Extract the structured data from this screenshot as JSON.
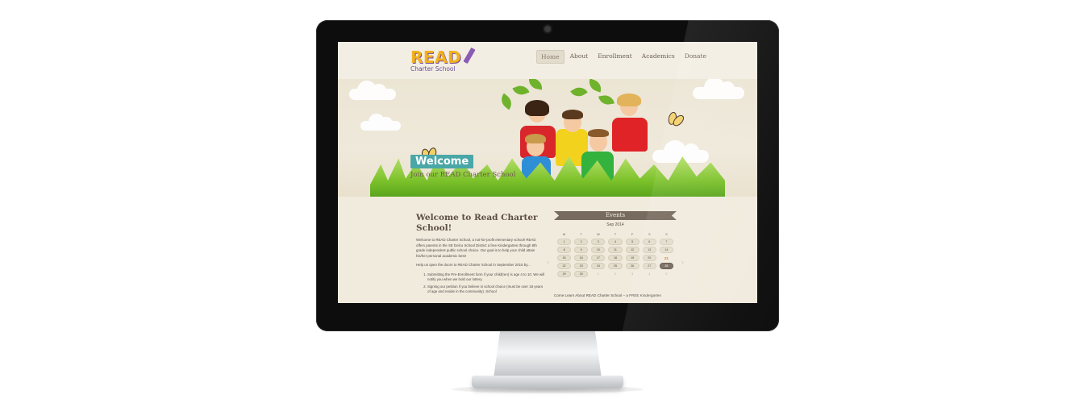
{
  "site": {
    "logo_main": "READ",
    "logo_sub": "Charter School"
  },
  "nav": [
    {
      "label": "Home",
      "active": true
    },
    {
      "label": "About",
      "active": false
    },
    {
      "label": "Enrollment",
      "active": false
    },
    {
      "label": "Academics",
      "active": false
    },
    {
      "label": "Donate",
      "active": false
    }
  ],
  "hero": {
    "badge": "Welcome",
    "subtitle": "Join our READ Charter School"
  },
  "main": {
    "heading": "Welcome to Read Charter School!",
    "intro": "Welcome to READ Charter School, a not-for-profit elementary school! READ offers parents in the SE Delco School District a free Kindergarten through 8th grade independent public school choice. Our goal is to help your child attain his/her personal academic best!",
    "cta": "Help us open the doors to READ Charter School in September 2015 by...",
    "steps": [
      "Submitting the Pre-Enrollment form if your child(ren) is age 4 to 10. We will notify you when we hold our lottery.",
      "Signing our petition if you believe in school choice (must be over 18 years of age and reside in the community). School"
    ]
  },
  "events": {
    "title": "Events",
    "month": "Sep 2014",
    "weekdays": [
      "M",
      "T",
      "W",
      "T",
      "F",
      "S",
      "S"
    ],
    "weeks": [
      [
        {
          "d": "1"
        },
        {
          "d": "2"
        },
        {
          "d": "3"
        },
        {
          "d": "4"
        },
        {
          "d": "5"
        },
        {
          "d": "6"
        },
        {
          "d": "7"
        }
      ],
      [
        {
          "d": "8"
        },
        {
          "d": "9"
        },
        {
          "d": "10"
        },
        {
          "d": "11"
        },
        {
          "d": "12"
        },
        {
          "d": "13"
        },
        {
          "d": "14"
        }
      ],
      [
        {
          "d": "15"
        },
        {
          "d": "16"
        },
        {
          "d": "17"
        },
        {
          "d": "18"
        },
        {
          "d": "19"
        },
        {
          "d": "20"
        },
        {
          "d": "21",
          "state": "today"
        }
      ],
      [
        {
          "d": "22"
        },
        {
          "d": "23"
        },
        {
          "d": "24"
        },
        {
          "d": "25"
        },
        {
          "d": "26"
        },
        {
          "d": "27"
        },
        {
          "d": "28",
          "state": "selected"
        }
      ],
      [
        {
          "d": "29"
        },
        {
          "d": "30"
        },
        {
          "d": "1",
          "state": "muted"
        },
        {
          "d": "2",
          "state": "muted"
        },
        {
          "d": "3",
          "state": "muted"
        },
        {
          "d": "4",
          "state": "muted"
        },
        {
          "d": "5",
          "state": "muted"
        }
      ]
    ],
    "nav_prev": "‹",
    "nav_next": "›",
    "featured_text": "Come Learn About READ Charter School – a FREE Kindergarten"
  }
}
